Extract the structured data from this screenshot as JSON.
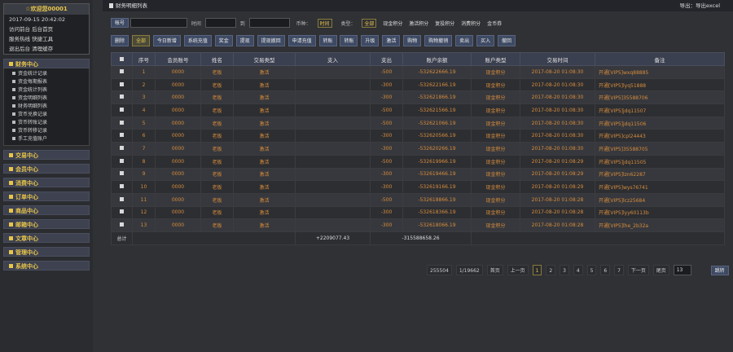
{
  "welcome": {
    "title": "☆欢迎您00001",
    "lines": [
      "2017-09-15 20:42:02",
      "访问前台 后台首页",
      "服务热线 快捷工具",
      "退出后台 清理缓存"
    ]
  },
  "sidebar": {
    "finance_title": "财务中心",
    "finance_items": [
      "资金统计记录",
      "资金每期报表",
      "资金统计列表",
      "资金明细列表",
      "财务明细列表",
      "货币兑换记录",
      "货币转账记录",
      "货币转移记录",
      "手工充值账户"
    ],
    "sections": [
      "交易中心",
      "会员中心",
      "消费中心",
      "订单中心",
      "商品中心",
      "邮箱中心",
      "文章中心",
      "管理中心",
      "系统中心"
    ]
  },
  "topbar": {
    "title": "财务明细列表",
    "export": "导出：导出excel"
  },
  "filter": {
    "account_btn": "帐号",
    "time_label": "时间",
    "to_label": "到",
    "currency_label": "币种：",
    "currency_value": "时间",
    "type_label": "类型：",
    "types": [
      "全部",
      "现金积分",
      "激活积分",
      "复投积分",
      "消费积分",
      "金币券"
    ]
  },
  "tabs": [
    "删除",
    "全部",
    "今日新增",
    "系统充值",
    "奖金",
    "提现",
    "提现撤回",
    "申请充值",
    "转账",
    "转账",
    "升级",
    "激活",
    "购物",
    "购物撤销",
    "卖出",
    "买入",
    "撤回"
  ],
  "table": {
    "headers": [
      "■",
      "序号",
      "会员账号",
      "姓名",
      "交易类型",
      "支入",
      "支出",
      "账户余额",
      "账户类型",
      "交易时间",
      "备注"
    ],
    "rows": [
      [
        "1",
        "0000",
        "老板",
        "激活",
        "",
        "-500",
        "-532622666.19",
        "现金积分",
        "2017-08-20 01:08:30",
        "开通[VIP5]wxq88885"
      ],
      [
        "2",
        "0000",
        "老板",
        "激活",
        "",
        "-300",
        "-532622166.19",
        "现金积分",
        "2017-08-20 01:08:30",
        "开通[VIP5]lyq51888"
      ],
      [
        "3",
        "0000",
        "老板",
        "激活",
        "",
        "-300",
        "-532621866.19",
        "现金积分",
        "2017-08-20 01:08:30",
        "开通[VIP5]35588706"
      ],
      [
        "4",
        "0000",
        "老板",
        "激活",
        "",
        "-500",
        "-532621566.19",
        "现金积分",
        "2017-08-20 01:08:30",
        "开通[VIP5]jdq11507"
      ],
      [
        "5",
        "0000",
        "老板",
        "激活",
        "",
        "-500",
        "-532621066.19",
        "现金积分",
        "2017-08-20 01:08:30",
        "开通[VIP5]jdq11506"
      ],
      [
        "6",
        "0000",
        "老板",
        "激活",
        "",
        "-300",
        "-532620566.19",
        "现金积分",
        "2017-08-20 01:08:30",
        "开通[VIP5]cpl24443"
      ],
      [
        "7",
        "0000",
        "老板",
        "激活",
        "",
        "-300",
        "-532620266.19",
        "现金积分",
        "2017-08-20 01:08:30",
        "开通[VIP5]35588705"
      ],
      [
        "8",
        "0000",
        "老板",
        "激活",
        "",
        "-500",
        "-532619966.19",
        "现金积分",
        "2017-08-20 01:08:29",
        "开通[VIP5]jdq11505"
      ],
      [
        "9",
        "0000",
        "老板",
        "激活",
        "",
        "-300",
        "-532619466.19",
        "现金积分",
        "2017-08-20 01:08:29",
        "开通[VIP5]lzn62287"
      ],
      [
        "10",
        "0000",
        "老板",
        "激活",
        "",
        "-300",
        "-532619166.19",
        "现金积分",
        "2017-08-20 01:08:29",
        "开通[VIP5]wys76741"
      ],
      [
        "11",
        "0000",
        "老板",
        "激活",
        "",
        "-500",
        "-532618866.19",
        "现金积分",
        "2017-08-20 01:08:28",
        "开通[VIP5]lcz25684"
      ],
      [
        "12",
        "0000",
        "老板",
        "激活",
        "",
        "-300",
        "-532618366.19",
        "现金积分",
        "2017-08-20 01:08:28",
        "开通[VIP5]lyy60113b"
      ],
      [
        "13",
        "0000",
        "老板",
        "激活",
        "",
        "-300",
        "-532618066.19",
        "现金积分",
        "2017-08-20 01:08:28",
        "开通[VIP5]lhe_2b32a"
      ]
    ],
    "total_label": "总计",
    "total_in": "+2209077.43",
    "total_out": "-315588658.26"
  },
  "pager": {
    "total": "255504",
    "pages": "1/19662",
    "first": "首页",
    "prev": "上一页",
    "numbers": [
      "1",
      "2",
      "3",
      "4",
      "5",
      "6",
      "7"
    ],
    "current": "1",
    "next": "下一页",
    "last": "尾页",
    "goto_value": "13",
    "goto_btn": "跳转"
  }
}
